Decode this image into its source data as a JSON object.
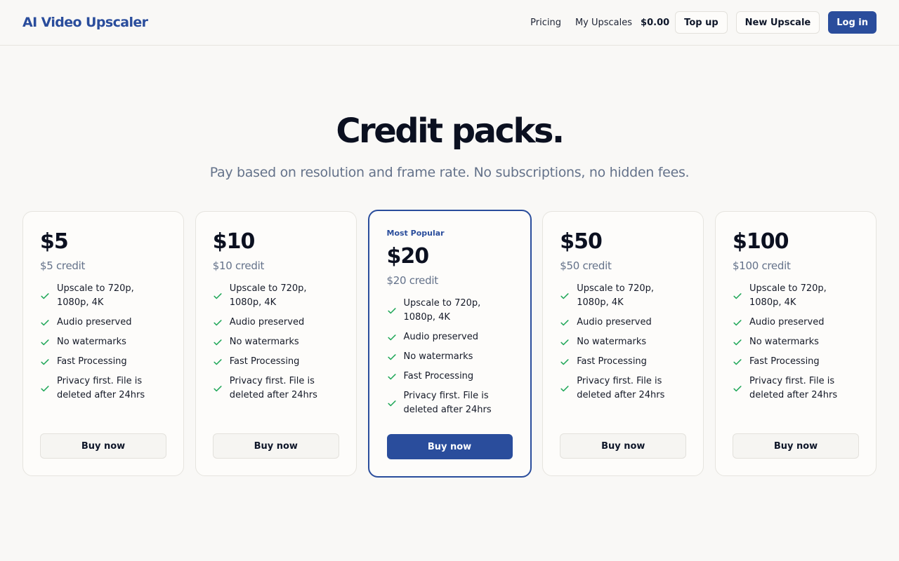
{
  "header": {
    "brand": "AI Video Upscaler",
    "nav": [
      "Pricing",
      "My Upscales"
    ],
    "balance": "$0.00",
    "topup_label": "Top up",
    "new_upscale_label": "New Upscale",
    "login_label": "Log in"
  },
  "hero": {
    "title": "Credit packs.",
    "subtitle": "Pay based on resolution and frame rate. No subscriptions, no hidden fees."
  },
  "features": [
    "Upscale to 720p, 1080p, 4K",
    "Audio preserved",
    "No watermarks",
    "Fast Processing",
    "Privacy first. File is deleted after 24hrs"
  ],
  "packs": [
    {
      "price": "$5",
      "credit": "$5 credit",
      "buy_label": "Buy now"
    },
    {
      "price": "$10",
      "credit": "$10 credit",
      "buy_label": "Buy now"
    },
    {
      "badge": "Most Popular",
      "price": "$20",
      "credit": "$20 credit",
      "buy_label": "Buy now"
    },
    {
      "price": "$50",
      "credit": "$50 credit",
      "buy_label": "Buy now"
    },
    {
      "price": "$100",
      "credit": "$100 credit",
      "buy_label": "Buy now"
    }
  ],
  "colors": {
    "accent": "#2a4d9c",
    "check": "#22a85a",
    "background": "#f9f8f6"
  }
}
